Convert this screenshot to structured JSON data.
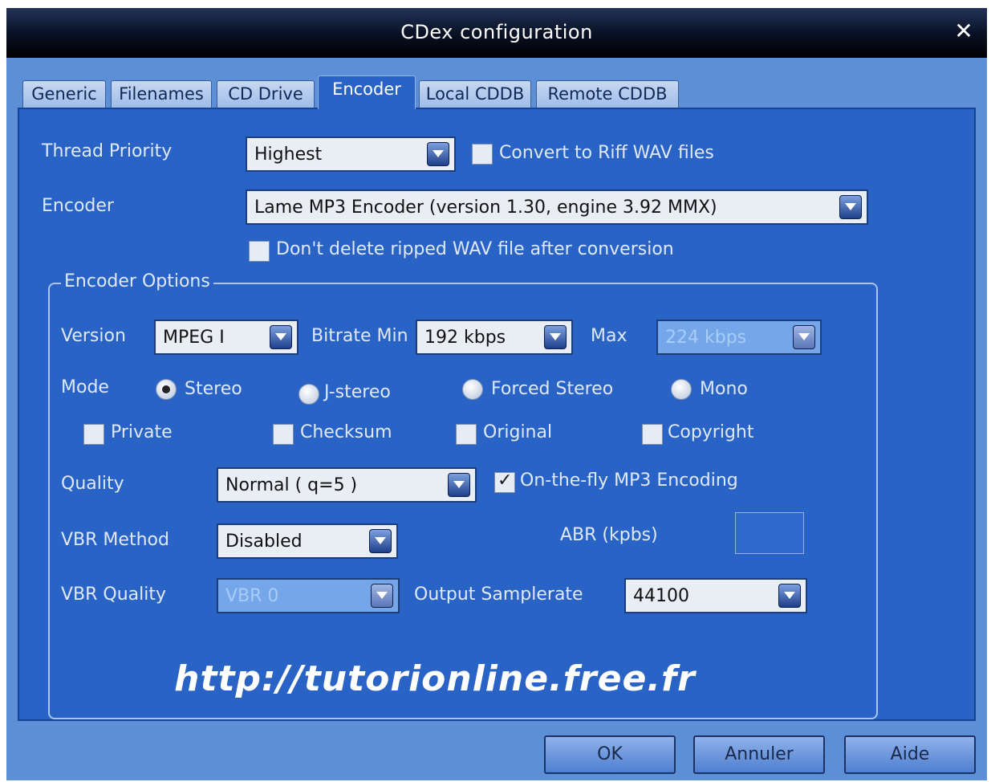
{
  "window": {
    "title": "CDex configuration",
    "close_label": "✕"
  },
  "tabs": [
    {
      "label": "Generic",
      "active": false
    },
    {
      "label": "Filenames",
      "active": false
    },
    {
      "label": "CD Drive",
      "active": false
    },
    {
      "label": "Encoder",
      "active": true
    },
    {
      "label": "Local CDDB",
      "active": false
    },
    {
      "label": "Remote CDDB",
      "active": false
    }
  ],
  "thread_priority": {
    "label": "Thread Priority",
    "value": "Highest"
  },
  "convert_riff": {
    "label": "Convert to Riff WAV files",
    "checked": false
  },
  "encoder": {
    "label": "Encoder",
    "value": "Lame MP3 Encoder (version 1.30, engine 3.92 MMX)"
  },
  "dont_delete": {
    "label": "Don't delete ripped WAV file after conversion",
    "checked": false
  },
  "encoder_options": {
    "legend": "Encoder Options",
    "version": {
      "label": "Version",
      "value": "MPEG I"
    },
    "bitrate_min": {
      "label": "Bitrate Min",
      "value": "192 kbps"
    },
    "bitrate_max": {
      "label": "Max",
      "value": "224 kbps",
      "disabled": true
    },
    "mode": {
      "label": "Mode",
      "options": [
        {
          "label": "Stereo",
          "selected": true
        },
        {
          "label": "J-stereo",
          "selected": false
        },
        {
          "label": "Forced Stereo",
          "selected": false
        },
        {
          "label": "Mono",
          "selected": false
        }
      ]
    },
    "flags": [
      {
        "label": "Private",
        "checked": false
      },
      {
        "label": "Checksum",
        "checked": false
      },
      {
        "label": "Original",
        "checked": false
      },
      {
        "label": "Copyright",
        "checked": false
      }
    ],
    "quality": {
      "label": "Quality",
      "value": "Normal ( q=5 )"
    },
    "on_the_fly": {
      "label": "On-the-fly MP3 Encoding",
      "checked": true
    },
    "vbr_method": {
      "label": "VBR Method",
      "value": "Disabled"
    },
    "abr": {
      "label": "ABR (kpbs)",
      "value": ""
    },
    "vbr_quality": {
      "label": "VBR Quality",
      "value": "VBR 0",
      "disabled": true
    },
    "output_samplerate": {
      "label": "Output Samplerate",
      "value": "44100"
    }
  },
  "watermark": "http://tutorionline.free.fr",
  "buttons": {
    "ok": "OK",
    "cancel": "Annuler",
    "help": "Aide"
  }
}
